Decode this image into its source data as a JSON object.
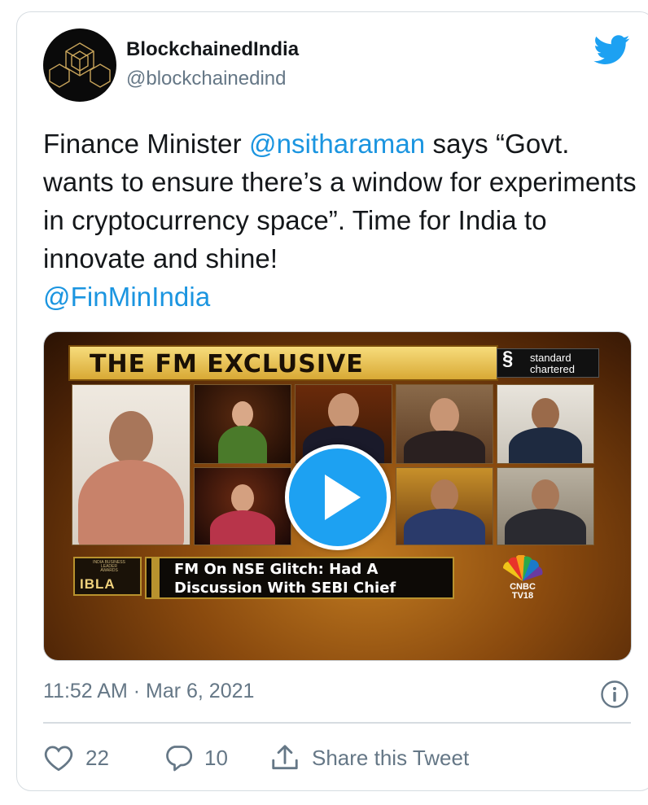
{
  "user": {
    "display_name": "BlockchainedIndia",
    "handle": "@blockchainedind"
  },
  "tweet": {
    "text_part1": "Finance Minister ",
    "mention1": "@nsitharaman",
    "text_part2": " says “Govt. wants to ensure there’s a window for experiments in cryptocurrency space”. Time for India to innovate and shine!",
    "mention2": "@FinMinIndia",
    "timestamp": "11:52 AM · Mar 6, 2021"
  },
  "media": {
    "banner_title": "THE FM EXCLUSIVE",
    "sponsor_line1": "standard",
    "sponsor_line2": "chartered",
    "ibla_label": "IBLA",
    "ibla_small": "INDIA BUSINESS LEADER AWARDS",
    "ticker_line1": "FM On NSE Glitch: Had A",
    "ticker_line2": "Discussion With SEBI Chief",
    "channel_line1": "CNBC",
    "channel_line2": "TV18"
  },
  "actions": {
    "likes": "22",
    "replies": "10",
    "share_label": "Share this Tweet"
  },
  "colors": {
    "link": "#1b95e0",
    "twitter_blue": "#1da1f2",
    "secondary_text": "#657786"
  },
  "icons": [
    "twitter-bird-icon",
    "play-icon",
    "info-icon",
    "heart-icon",
    "reply-icon",
    "share-icon"
  ]
}
